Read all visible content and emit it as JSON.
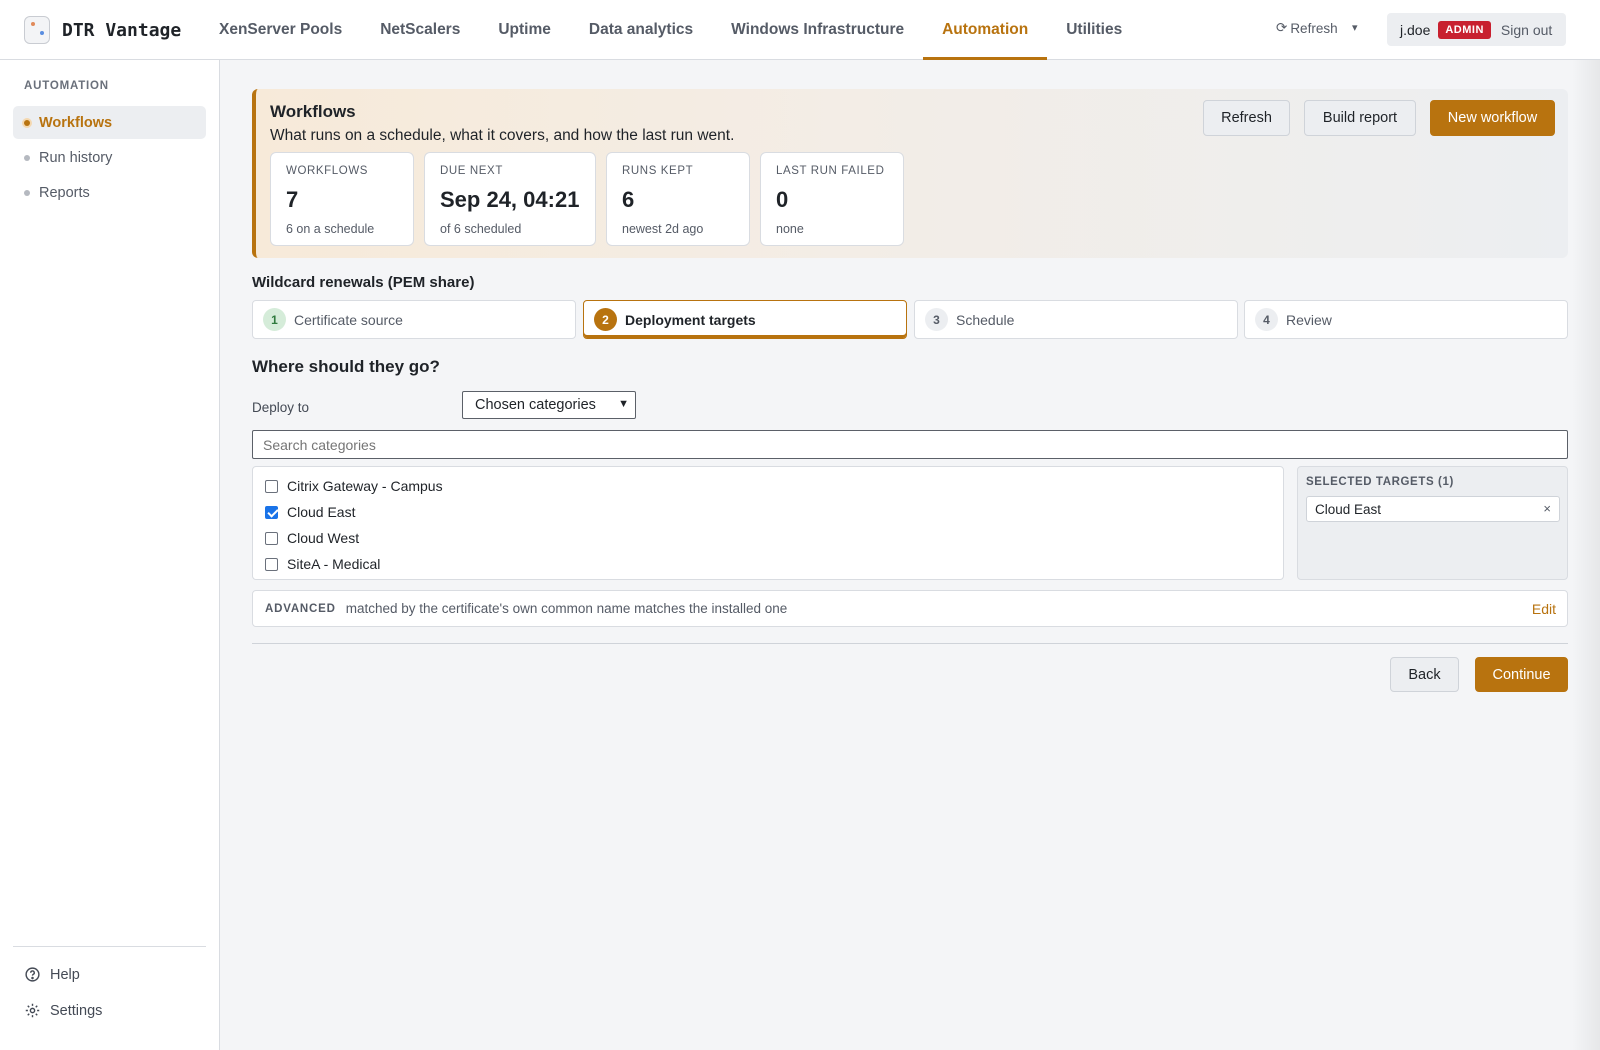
{
  "brand": {
    "name": "DTR Vantage"
  },
  "nav": {
    "tabs": [
      {
        "label": "XenServer Pools",
        "active": false
      },
      {
        "label": "NetScalers",
        "active": false
      },
      {
        "label": "Uptime",
        "active": false
      },
      {
        "label": "Data analytics",
        "active": false
      },
      {
        "label": "Windows Infrastructure",
        "active": false
      },
      {
        "label": "Automation",
        "active": true
      },
      {
        "label": "Utilities",
        "active": false
      }
    ],
    "refresh_icon": "⟳",
    "refresh_label": "Refresh",
    "caret": "▾",
    "user": "j.doe",
    "role_badge": "ADMIN",
    "signout": "Sign out"
  },
  "sidebar": {
    "title": "AUTOMATION",
    "items": [
      {
        "label": "Workflows",
        "active": true
      },
      {
        "label": "Run history",
        "active": false
      },
      {
        "label": "Reports",
        "active": false
      }
    ],
    "footer": {
      "help": "Help",
      "settings": "Settings"
    }
  },
  "hero": {
    "title": "Workflows",
    "subtitle": "What runs on a schedule, what it covers, and how the last run went.",
    "buttons": {
      "refresh": "Refresh",
      "build_report": "Build report",
      "new_workflow": "New workflow"
    },
    "stats": [
      {
        "label": "WORKFLOWS",
        "value": "7",
        "note": "6 on a schedule"
      },
      {
        "label": "DUE NEXT",
        "value": "Sep 24, 04:21",
        "note": "of 6 scheduled"
      },
      {
        "label": "RUNS KEPT",
        "value": "6",
        "note": "newest 2d ago"
      },
      {
        "label": "LAST RUN FAILED",
        "value": "0",
        "note": "none"
      }
    ]
  },
  "wizard": {
    "title": "Wildcard renewals (PEM share)",
    "steps": [
      {
        "num": "1",
        "label": "Certificate source",
        "state": "done"
      },
      {
        "num": "2",
        "label": "Deployment targets",
        "state": "active"
      },
      {
        "num": "3",
        "label": "Schedule",
        "state": "pending"
      },
      {
        "num": "4",
        "label": "Review",
        "state": "pending"
      }
    ],
    "heading": "Where should they go?",
    "deploy_label": "Deploy to",
    "deploy_value": "Chosen categories",
    "search_placeholder": "Search categories",
    "categories": [
      {
        "label": "Citrix Gateway - Campus",
        "checked": false
      },
      {
        "label": "Cloud East",
        "checked": true
      },
      {
        "label": "Cloud West",
        "checked": false
      },
      {
        "label": "SiteA - Medical",
        "checked": false
      }
    ],
    "selected_title": "SELECTED TARGETS (1)",
    "selected": [
      "Cloud East"
    ],
    "remove_glyph": "×",
    "advanced_tag": "ADVANCED",
    "advanced_text": "matched by the certificate's own common name matches the installed one",
    "advanced_edit": "Edit",
    "back": "Back",
    "continue": "Continue"
  },
  "colors": {
    "accent": "#b8730f",
    "admin_badge": "#c8202f",
    "checkbox": "#1a73e8"
  }
}
